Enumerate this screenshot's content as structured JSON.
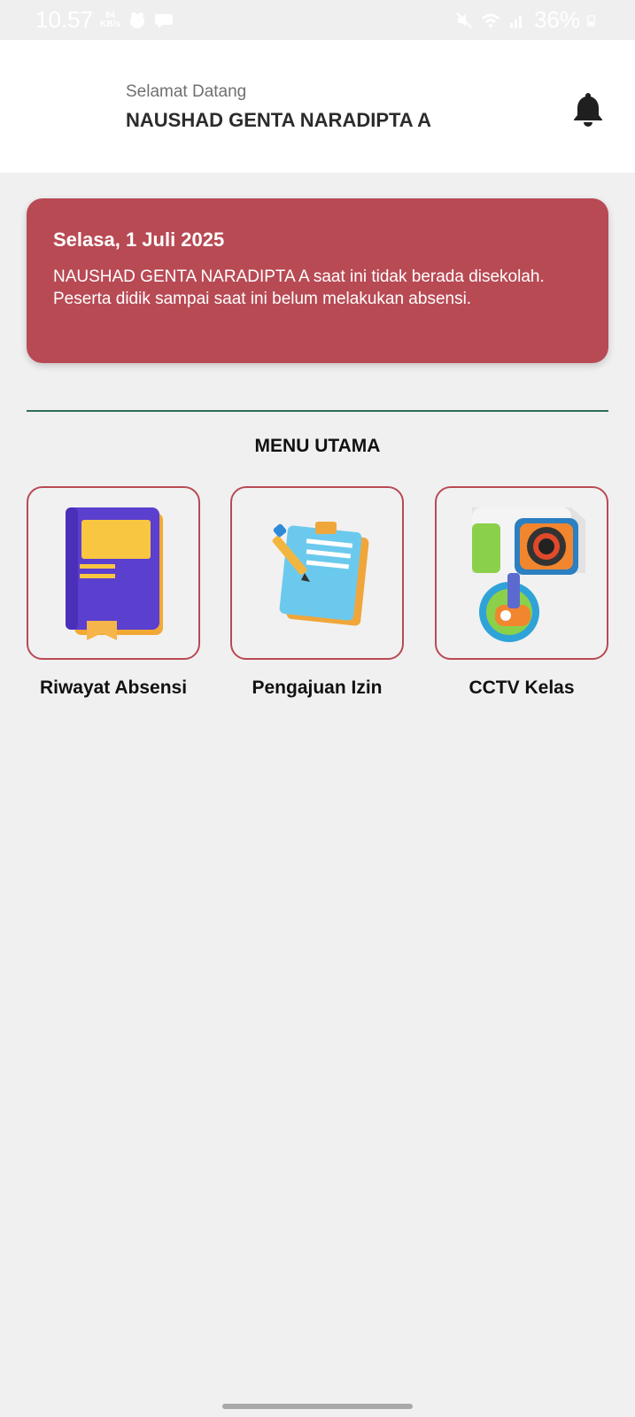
{
  "status_bar": {
    "time": "10.57",
    "net_speed_value": "84",
    "net_speed_unit": "KB/s",
    "battery": "36%"
  },
  "header": {
    "greeting": "Selamat Datang",
    "user_name": "NAUSHAD GENTA NARADIPTA A",
    "notification_icon": "bell-icon"
  },
  "alert": {
    "date": "Selasa, 1 Juli 2025",
    "message": "NAUSHAD GENTA NARADIPTA A saat ini tidak berada disekolah. Peserta didik sampai saat ini belum melakukan absensi.",
    "color": "#b84a54"
  },
  "menu": {
    "title": "MENU UTAMA",
    "items": [
      {
        "label": "Riwayat Absensi",
        "icon": "book-icon"
      },
      {
        "label": "Pengajuan Izin",
        "icon": "notepad-icon"
      },
      {
        "label": "CCTV Kelas",
        "icon": "cctv-camera-icon"
      }
    ]
  },
  "colors": {
    "accent": "#b84a54",
    "divider": "#2e6e5a",
    "background": "#f0f0f0"
  }
}
